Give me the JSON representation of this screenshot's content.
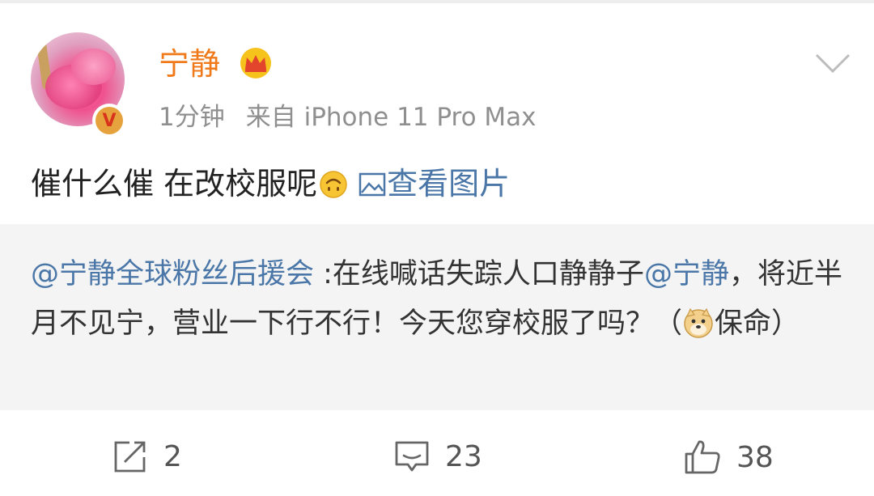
{
  "user": {
    "name": "宁静",
    "time": "1分钟",
    "source": "来自 iPhone 11 Pro Max"
  },
  "post": {
    "text": "催什么催 在改校服呢",
    "view_pic": "查看图片"
  },
  "quote": {
    "mention1": "@宁静全球粉丝后援会",
    "text1": " :在线喊话失踪人口静静子",
    "mention2": "@宁静",
    "text2": "，将近半月不见宁，营业一下行不行！今天您穿校服了吗？（",
    "text3": "保命）"
  },
  "actions": {
    "repost_count": "2",
    "comment_count": "23",
    "like_count": "38"
  },
  "colors": {
    "username": "#f07a1a",
    "link": "#4a77a8",
    "meta": "#8f8f8f",
    "quote_bg": "#f4f4f4"
  },
  "icons": [
    "verified-v-icon",
    "crown-icon",
    "chevron-down-icon",
    "upside-down-smile-emoji",
    "picture-icon",
    "doge-emoji",
    "repost-icon",
    "comment-icon",
    "like-icon"
  ]
}
